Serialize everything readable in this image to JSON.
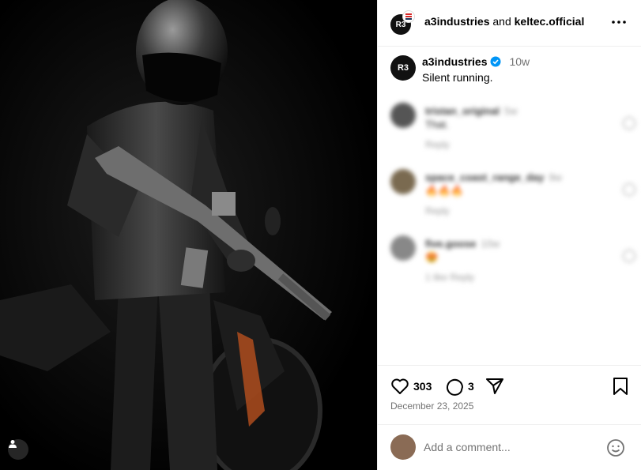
{
  "post": {
    "author": "a3industries",
    "collaborator": "keltec.official",
    "connector": "and",
    "avatar_initials": "R3",
    "verified": true,
    "time_ago": "10w",
    "caption": "Silent running.",
    "likes": "303",
    "comments_count": "3",
    "date": "December 23, 2025"
  },
  "comments": [
    {
      "user": "tristan_original",
      "time": "5w",
      "text": "That.",
      "reply": "Reply"
    },
    {
      "user": "space_coast_range_day",
      "time": "9w",
      "text": "🔥🔥🔥",
      "reply": "Reply"
    },
    {
      "user": "five.goose",
      "time": "10w",
      "text": "😍",
      "reply": "1 like   Reply"
    }
  ],
  "add_comment": {
    "placeholder": "Add a comment..."
  },
  "icons": {
    "more": "more-horizontal-icon",
    "like": "heart-icon",
    "comment": "comment-bubble-icon",
    "share": "send-icon",
    "save": "bookmark-icon",
    "emoji": "emoji-icon",
    "tags": "user-tag-icon",
    "verified": "verified-badge-icon"
  },
  "colors": {
    "verified": "#0095f6",
    "muted": "#737373",
    "border": "#efefef"
  }
}
